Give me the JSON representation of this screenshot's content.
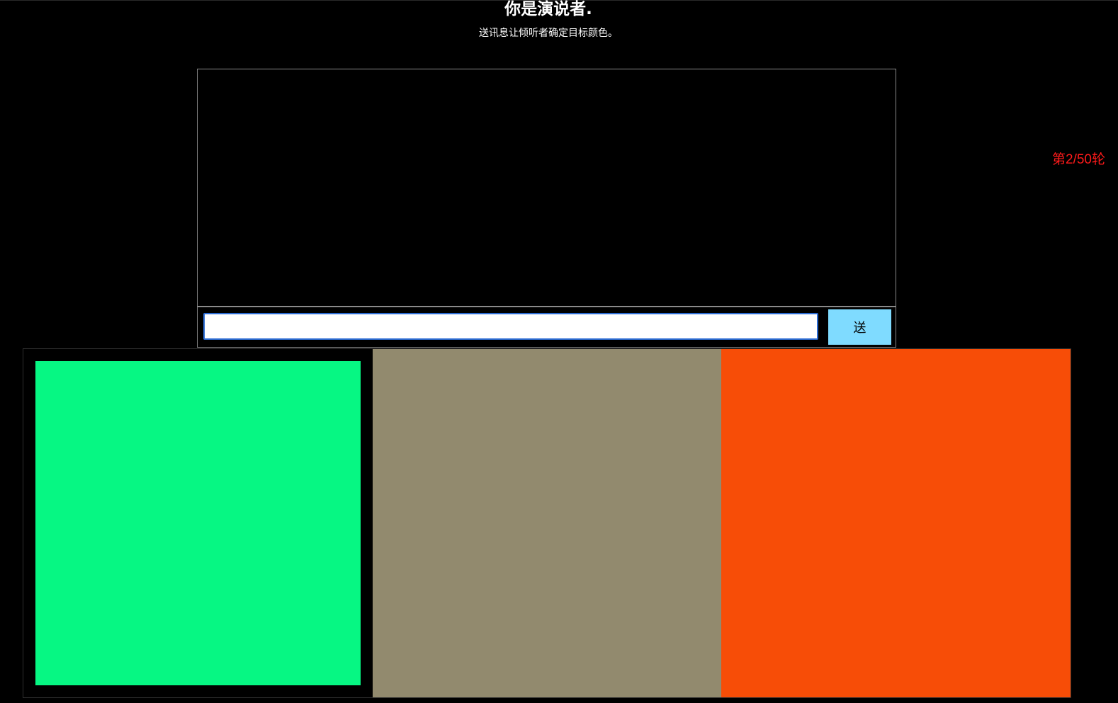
{
  "header": {
    "title": "你是演说者.",
    "subtitle": "送讯息让倾听者确定目标颜色。"
  },
  "status": {
    "round_text": "第2/50轮",
    "round_current": 2,
    "round_total": 50,
    "color": "#ff1a1a"
  },
  "chat": {
    "messages": [],
    "input_value": "",
    "send_label": "送",
    "send_color": "#7fdbff"
  },
  "swatches": [
    {
      "color": "#06f783",
      "selected": true
    },
    {
      "color": "#928a6e",
      "selected": false
    },
    {
      "color": "#f74d07",
      "selected": false
    }
  ]
}
